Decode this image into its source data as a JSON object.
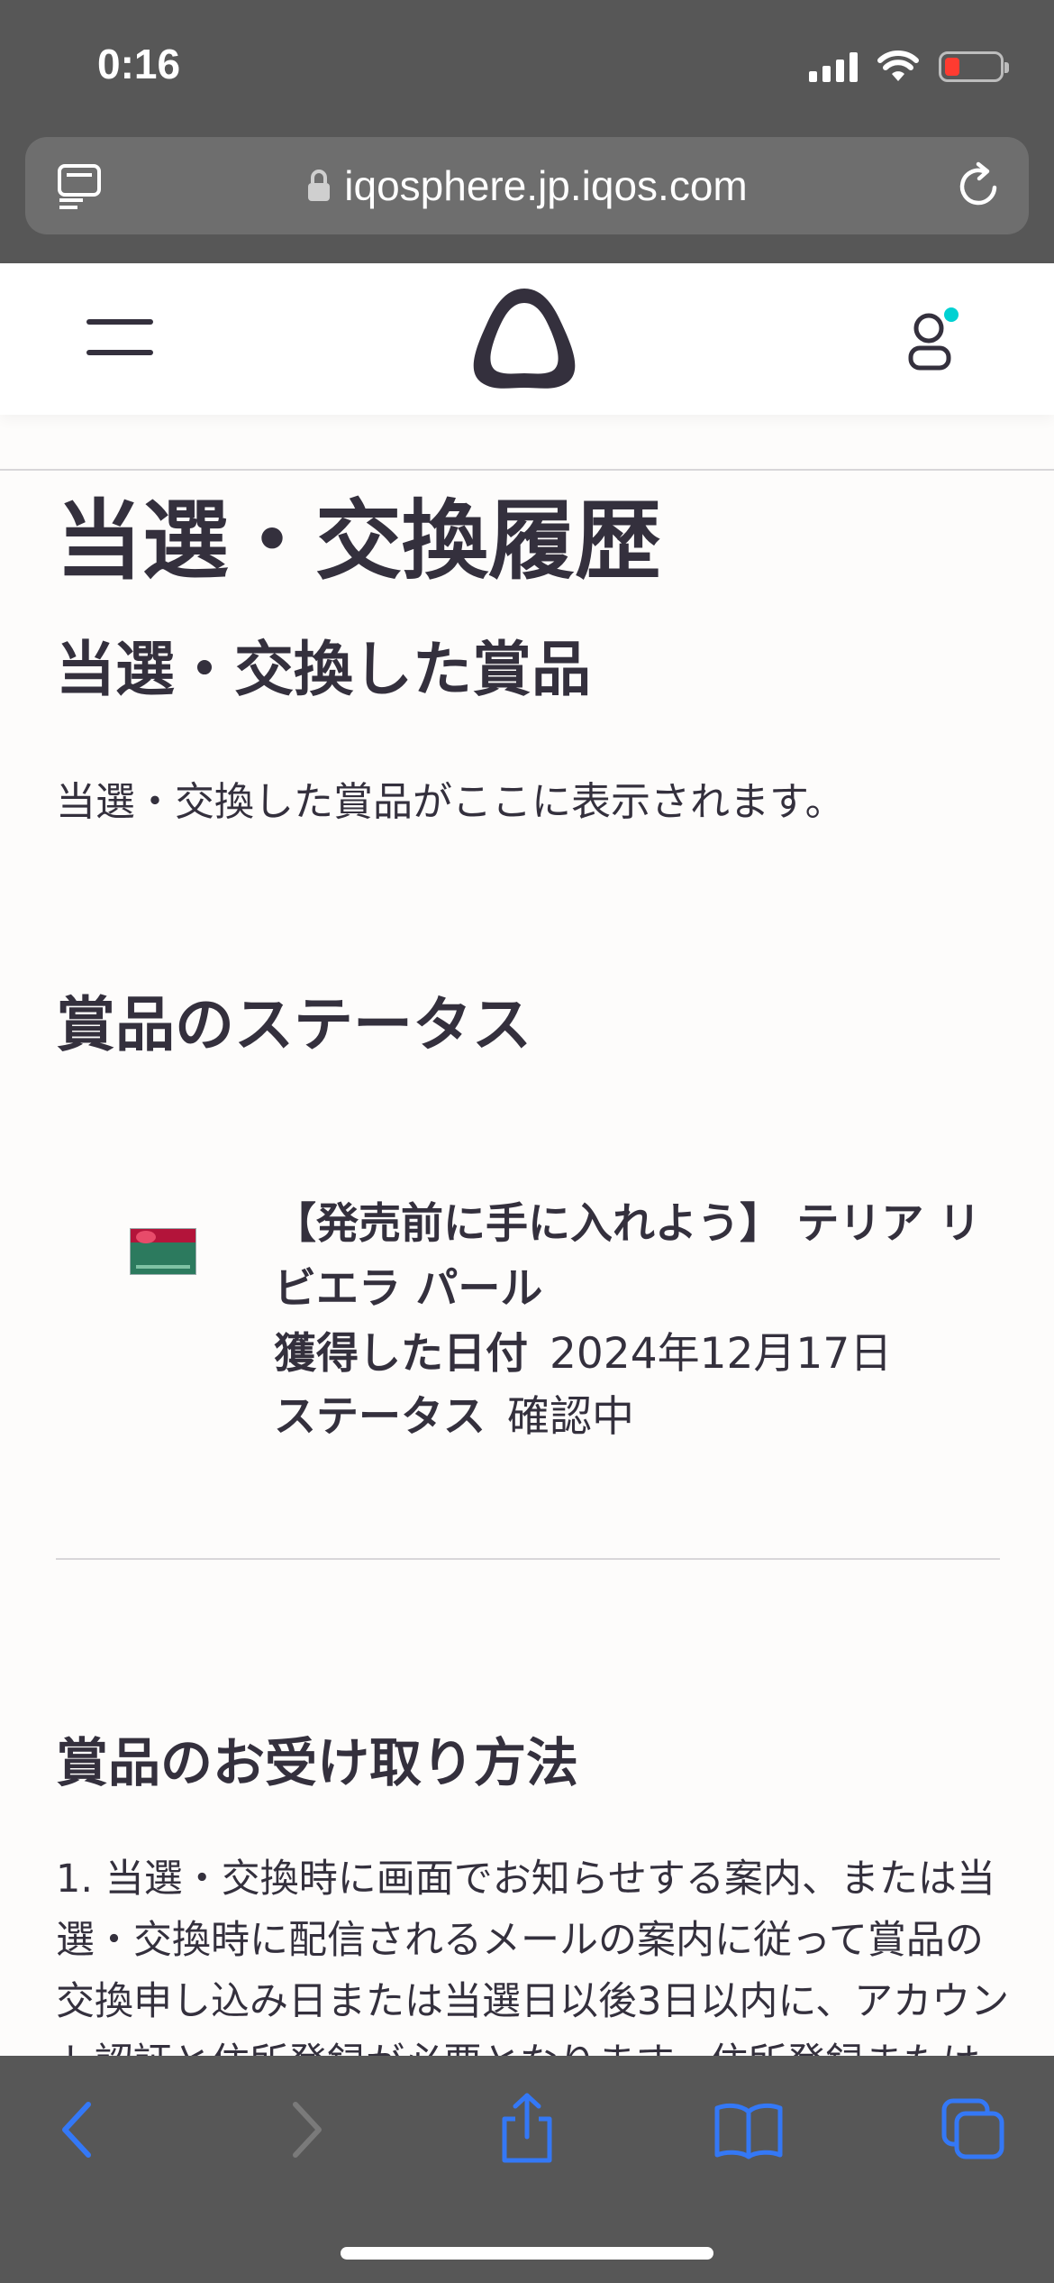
{
  "status_bar": {
    "time": "0:16"
  },
  "browser": {
    "url": "iqosphere.jp.iqos.com"
  },
  "page": {
    "title": "当選・交換履歴",
    "won_section_title": "当選・交換した賞品",
    "won_section_description": "当選・交換した賞品がここに表示されます。",
    "status_section_title": "賞品のステータス",
    "prize": {
      "name": "【発売前に手に入れよう】 テリア リビエラ パール",
      "date_label": "獲得した日付",
      "date_value": "2024年12月17日",
      "status_label": "ステータス",
      "status_value": "確認中"
    },
    "receive_section_title": "賞品のお受け取り方法",
    "receive_text": "1. 当選・交換時に画面でお知らせする案内、または当選・交換時に配信されるメールの案内に従って賞品の交換申し込み日または当選日以後3日以内に、アカウント認証と住所登録が必要となります。住所登録またはすで"
  },
  "colors": {
    "text": "#34303D",
    "chrome": "#575757",
    "accent": "#00D1D2",
    "ios_blue": "#3478F6"
  },
  "icons": {
    "tabs": "tabs-icon",
    "lock": "lock-icon",
    "reload": "reload-icon",
    "menu": "hamburger-icon",
    "logo": "iqos-logo",
    "user": "user-icon",
    "back": "back-icon",
    "forward": "forward-icon",
    "share": "share-icon",
    "bookmarks": "bookmarks-icon",
    "tab_switcher": "tab-switcher-icon"
  }
}
